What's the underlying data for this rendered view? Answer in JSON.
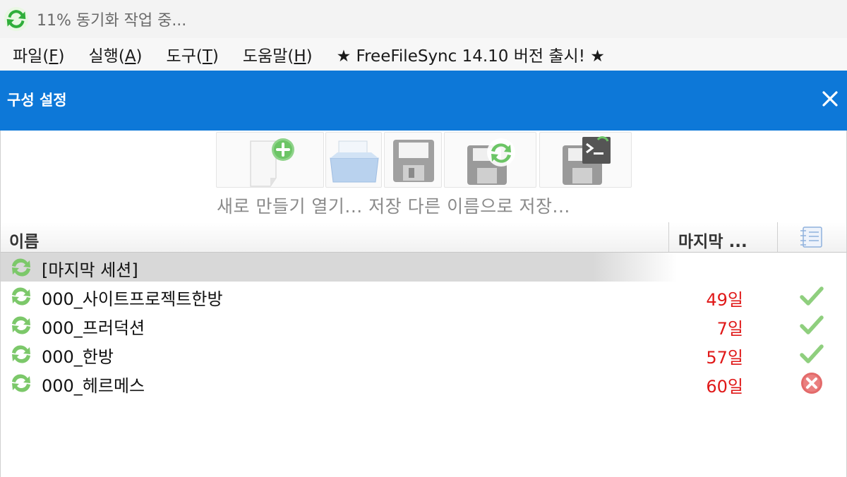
{
  "window": {
    "title": "11% 동기화 작업 중..."
  },
  "menu": {
    "items": [
      {
        "label": "파일(",
        "key": "F",
        "close": ")"
      },
      {
        "label": "실행(",
        "key": "A",
        "close": ")"
      },
      {
        "label": "도구(",
        "key": "T",
        "close": ")"
      },
      {
        "label": "도움말(",
        "key": "H",
        "close": ")"
      }
    ],
    "news": "★ FreeFileSync 14.10 버전 출시! ★"
  },
  "panel": {
    "title": "구성 설정"
  },
  "toolbar": {
    "labels": "새로 만들기 열기... 저장 다른 이름으로 저장...",
    "buttons": [
      "new-config",
      "open-config",
      "save-config",
      "save-as",
      "save-as-batch"
    ]
  },
  "table": {
    "col_name": "이름",
    "col_last": "마지막 ...",
    "rows": [
      {
        "name": "[마지막 세션]",
        "days": "",
        "status": "none",
        "selected": true
      },
      {
        "name": "000_사이트프로젝트한방",
        "days": "49일",
        "status": "ok"
      },
      {
        "name": "000_프러덕션",
        "days": "7일",
        "status": "ok"
      },
      {
        "name": "000_한방",
        "days": "57일",
        "status": "ok"
      },
      {
        "name": "000_헤르메스",
        "days": "60일",
        "status": "error"
      }
    ]
  },
  "colors": {
    "accent": "#0d78d8",
    "days_text": "#e01818",
    "ok_check": "#86c86e",
    "error": "#e05555"
  }
}
